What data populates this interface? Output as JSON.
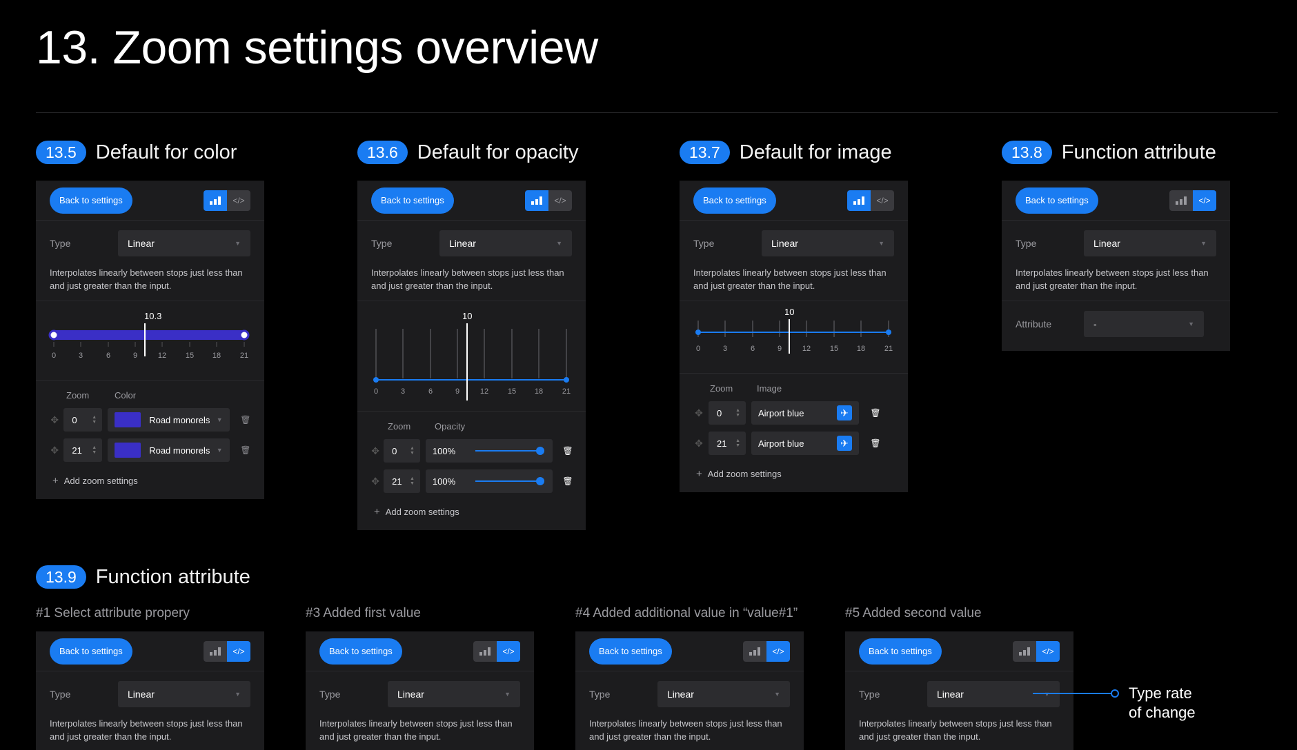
{
  "page": {
    "title": "13. Zoom settings overview"
  },
  "common": {
    "back_label": "Back to settings",
    "type_label": "Type",
    "type_value": "Linear",
    "description": "Interpolates linearly between stops just less than and just greater than the input.",
    "add_label": "Add zoom settings",
    "zoom_col": "Zoom"
  },
  "sections": [
    {
      "badge": "13.5",
      "title": "Default for color"
    },
    {
      "badge": "13.6",
      "title": "Default for opacity"
    },
    {
      "badge": "13.7",
      "title": "Default for image"
    },
    {
      "badge": "13.8",
      "title": "Function attribute"
    },
    {
      "badge": "13.9",
      "title": "Function attribute"
    }
  ],
  "color_panel": {
    "slider_value": "10.3",
    "ticks": [
      "0",
      "3",
      "6",
      "9",
      "12",
      "15",
      "18",
      "21"
    ],
    "value_col": "Color",
    "stops": [
      {
        "zoom": "0",
        "value": "Road monorels"
      },
      {
        "zoom": "21",
        "value": "Road monorels"
      }
    ],
    "swatch_color": "#3a2fc6"
  },
  "opacity_panel": {
    "slider_value": "10",
    "ticks": [
      "0",
      "3",
      "6",
      "9",
      "12",
      "15",
      "18",
      "21"
    ],
    "value_col": "Opacity",
    "stops": [
      {
        "zoom": "0",
        "value": "100%"
      },
      {
        "zoom": "21",
        "value": "100%"
      }
    ]
  },
  "image_panel": {
    "slider_value": "10",
    "ticks": [
      "0",
      "3",
      "6",
      "9",
      "12",
      "15",
      "18",
      "21"
    ],
    "value_col": "Image",
    "stops": [
      {
        "zoom": "0",
        "value": "Airport blue"
      },
      {
        "zoom": "21",
        "value": "Airport blue"
      }
    ],
    "icon": "airplane-icon"
  },
  "attribute_panel": {
    "attribute_label": "Attribute",
    "attribute_value": "-"
  },
  "steps": [
    {
      "label": "#1 Select attribute propery"
    },
    {
      "label": "#3 Added first value"
    },
    {
      "label": "#4 Added additional value in “value#1”"
    },
    {
      "label": "#5 Added second value"
    }
  ],
  "callout": {
    "line1": "Type rate",
    "line2": "of change"
  },
  "colors": {
    "accent": "#1a7cf2",
    "panel": "#1c1c1e",
    "background": "#000000",
    "swatch": "#3a2fc6"
  }
}
